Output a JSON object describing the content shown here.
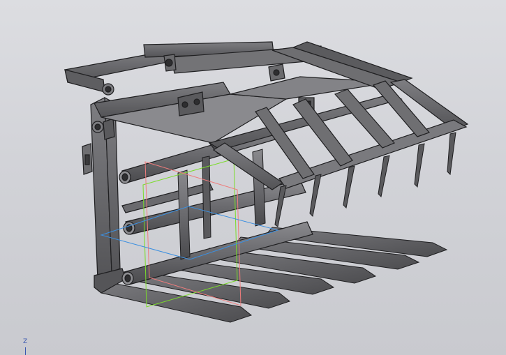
{
  "viewport": {
    "background_top": "#dcdde1",
    "background_bottom": "#c9cacf",
    "model_color": "#6b6b6e",
    "edge_color": "#1f1f21"
  },
  "planes": {
    "front_color": "#7bdc2a",
    "right_color": "#ef7c7c",
    "top_color": "#3b8fe0"
  },
  "axis": {
    "z_label": "Z",
    "color": "#3a57b0"
  }
}
